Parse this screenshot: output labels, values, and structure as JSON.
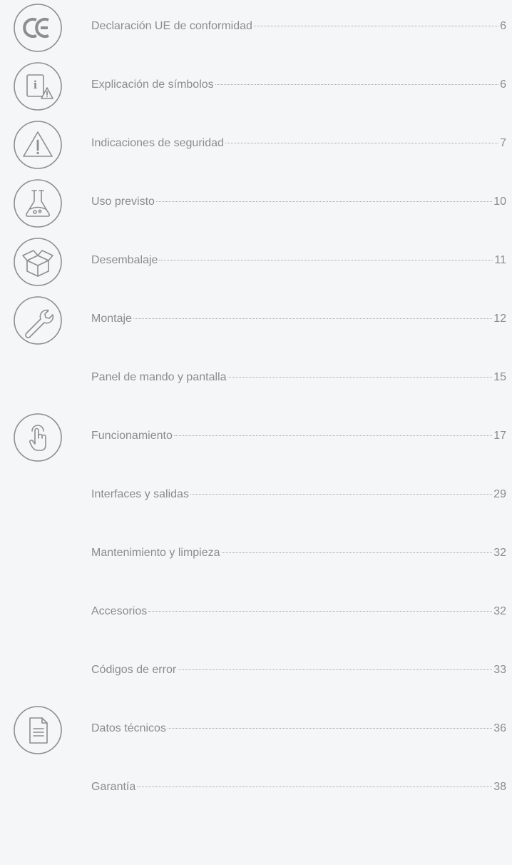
{
  "toc": [
    {
      "title": "Declaración UE de conformidad",
      "page": "6",
      "icon": "ce-mark-icon"
    },
    {
      "title": "Explicación de símbolos",
      "page": "6",
      "icon": "info-warning-icon"
    },
    {
      "title": "Indicaciones de seguridad",
      "page": "7",
      "icon": "warning-triangle-icon"
    },
    {
      "title": "Uso previsto",
      "page": "10",
      "icon": "lab-flask-icon"
    },
    {
      "title": "Desembalaje",
      "page": "11",
      "icon": "open-box-icon"
    },
    {
      "title": "Montaje",
      "page": "12",
      "icon": "wrench-icon"
    },
    {
      "title": "Panel de mando y pantalla",
      "page": "15",
      "icon": ""
    },
    {
      "title": "Funcionamiento",
      "page": "17",
      "icon": "hand-pointer-icon"
    },
    {
      "title": "Interfaces y salidas",
      "page": "29",
      "icon": ""
    },
    {
      "title": "Mantenimiento y limpieza",
      "page": "32",
      "icon": ""
    },
    {
      "title": "Accesorios",
      "page": "32",
      "icon": ""
    },
    {
      "title": "Códigos de error",
      "page": "33",
      "icon": ""
    },
    {
      "title": "Datos técnicos",
      "page": "36",
      "icon": "document-icon"
    },
    {
      "title": "Garantía",
      "page": "38",
      "icon": ""
    }
  ],
  "colors": {
    "background": "#f5f6f7",
    "text": "#8c8c8c",
    "icon_stroke": "#8e8e8e"
  }
}
